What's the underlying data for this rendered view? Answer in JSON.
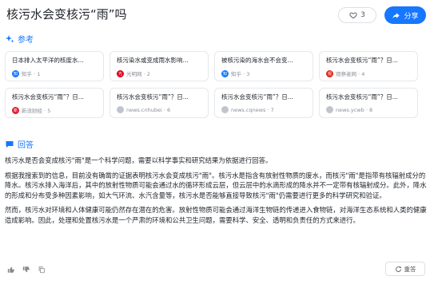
{
  "header": {
    "title": "核污水会变核污“雨”吗",
    "like_count": "3",
    "share_label": "分享"
  },
  "references": {
    "label": "参考",
    "cards": [
      {
        "title": "日本排入太平洋的核废水...",
        "source": "知乎 · 1",
        "icon": "zhihu-icon",
        "icon_char": "知",
        "icon_color": "#1677ff"
      },
      {
        "title": "核污染水或变成雨水影响...",
        "source": "光明网 · 2",
        "icon": "gmw-icon",
        "icon_char": "光",
        "icon_color": "#d9001b"
      },
      {
        "title": "被核污染的海水会不会变...",
        "source": "知乎 · 3",
        "icon": "zhihu-icon",
        "icon_char": "知",
        "icon_color": "#1677ff"
      },
      {
        "title": "核污水会变核污“雨”？日...",
        "source": "观察者网 · 4",
        "icon": "guancha-icon",
        "icon_char": "观",
        "icon_color": "#e2231a"
      },
      {
        "title": "核污水会变核污“雨”？日...",
        "source": "新浪财经 · 5",
        "icon": "sina-icon",
        "icon_char": "新",
        "icon_color": "#e6162d"
      },
      {
        "title": "核污水会变核污“雨”？日...",
        "source": "news.cnhubei · 6",
        "icon": "globe-icon",
        "icon_char": "",
        "icon_color": "#c0c4cc"
      },
      {
        "title": "核污水会变核污“雨”？日...",
        "source": "news.cqnews · 7",
        "icon": "globe-icon",
        "icon_char": "",
        "icon_color": "#c0c4cc"
      },
      {
        "title": "核污水会变核污“雨”？日...",
        "source": "news.ycwb · 8",
        "icon": "globe-icon",
        "icon_char": "",
        "icon_color": "#c0c4cc"
      }
    ]
  },
  "answer": {
    "label": "回答",
    "paragraphs": [
      "核污水是否会变成核污\"雨\"是一个科学问题，需要以科学事实和研究结果为依据进行回答。",
      "根据我搜索到的信息，目前没有确凿的证据表明核污水会变成核污\"雨\"。核污水是指含有放射性物质的废水，而核污\"雨\"是指带有核辐射成分的降水。核污水排入海洋后，其中的放射性物质可能会通过水的循环形成云层，但云层中的水滴形成的降水并不一定带有核辐射成分。此外，降水的形成和分布受多种因素影响，如大气环流、水汽含量等，核污水是否能够直接导致核污\"雨\"仍需要进行更多的科学研究和验证。",
      "然而，核污水对环境和人体健康可能仍然存在潜在的危害。放射性物质可能会通过海洋生物链的传递进入食物链，对海洋生态系统和人类的健康造成影响。因此，处理和处置核污水是一个严肃的环境和公共卫生问题，需要科学、安全、透明和负责任的方式来进行。"
    ]
  },
  "footer": {
    "regenerate_label": "重答"
  },
  "colors": {
    "accent": "#1677ff"
  }
}
